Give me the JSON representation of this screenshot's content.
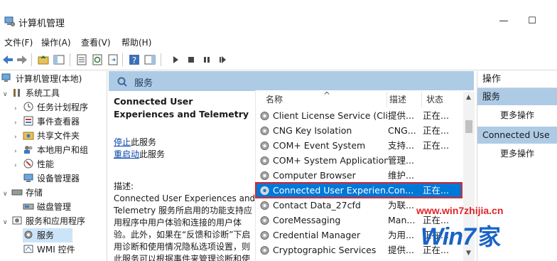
{
  "window": {
    "title": "计算机管理",
    "minimize": "—",
    "maximize": "☐"
  },
  "menu": [
    "文件(F)",
    "操作(A)",
    "查看(V)",
    "帮助(H)"
  ],
  "tree": [
    {
      "label": "计算机管理(本地)",
      "arrow": "",
      "icon": "computer-icon"
    },
    {
      "label": "系统工具",
      "arrow": "∨",
      "icon": "tools-icon"
    },
    {
      "label": "任务计划程序",
      "arrow": "›",
      "icon": "clock-icon"
    },
    {
      "label": "事件查看器",
      "arrow": "›",
      "icon": "event-viewer-icon"
    },
    {
      "label": "共享文件夹",
      "arrow": "›",
      "icon": "shared-folder-icon"
    },
    {
      "label": "本地用户和组",
      "arrow": "›",
      "icon": "users-icon"
    },
    {
      "label": "性能",
      "arrow": "›",
      "icon": "performance-icon"
    },
    {
      "label": "设备管理器",
      "arrow": "",
      "icon": "device-manager-icon"
    },
    {
      "label": "存储",
      "arrow": "∨",
      "icon": "storage-icon"
    },
    {
      "label": "磁盘管理",
      "arrow": "",
      "icon": "disk-icon"
    },
    {
      "label": "服务和应用程序",
      "arrow": "∨",
      "icon": "services-apps-icon"
    },
    {
      "label": "服务",
      "arrow": "",
      "icon": "gear-icon"
    },
    {
      "label": "WMI 控件",
      "arrow": "",
      "icon": "wmi-icon"
    }
  ],
  "main": {
    "header": "服务",
    "service_name": "Connected User Experiences and Telemetry",
    "stop_link": "停止",
    "stop_suffix": "此服务",
    "restart_link": "重启动",
    "restart_suffix": "此服务",
    "desc_label": "描述:",
    "desc_text": "Connected User Experiences and Telemetry 服务所启用的功能支持应用程序中用户体验和连接的用户体验。此外，如果在“反馈和诊断”下启用诊断和使用情况隐私选项设置，则此服务可以根据事件来管理诊断和使用"
  },
  "table": {
    "columns": {
      "name": "名称",
      "desc": "描述",
      "status": "状态"
    },
    "sort_arrow": "^",
    "rows": [
      {
        "name": "Client License Service (Cli...",
        "desc": "提供...",
        "status": "正在..."
      },
      {
        "name": "CNG Key Isolation",
        "desc": "CNG...",
        "status": "正在..."
      },
      {
        "name": "COM+ Event System",
        "desc": "支持...",
        "status": "正在..."
      },
      {
        "name": "COM+ System Application",
        "desc": "管理...",
        "status": ""
      },
      {
        "name": "Computer Browser",
        "desc": "维护...",
        "status": ""
      },
      {
        "name": "Connected User Experien...",
        "desc": "Con...",
        "status": "正在..."
      },
      {
        "name": "Contact Data_27cfd",
        "desc": "为联...",
        "status": ""
      },
      {
        "name": "CoreMessaging",
        "desc": "Man...",
        "status": "正在..."
      },
      {
        "name": "Credential Manager",
        "desc": "为用...",
        "status": "正在..."
      },
      {
        "name": "Cryptographic Services",
        "desc": "提供...",
        "status": "正在..."
      }
    ]
  },
  "actions": {
    "title": "操作",
    "group1": "服务",
    "group1_more": "更多操作",
    "group2": "Connected Use",
    "group2_more": "更多操作"
  },
  "watermark": {
    "url": "www.win7zhijia.cn",
    "logo": "Win7",
    "logo_suffix": "家"
  },
  "colors": {
    "header_bg": "#aecbe6",
    "selection": "#0078d7",
    "highlight_border": "#e0242a"
  }
}
